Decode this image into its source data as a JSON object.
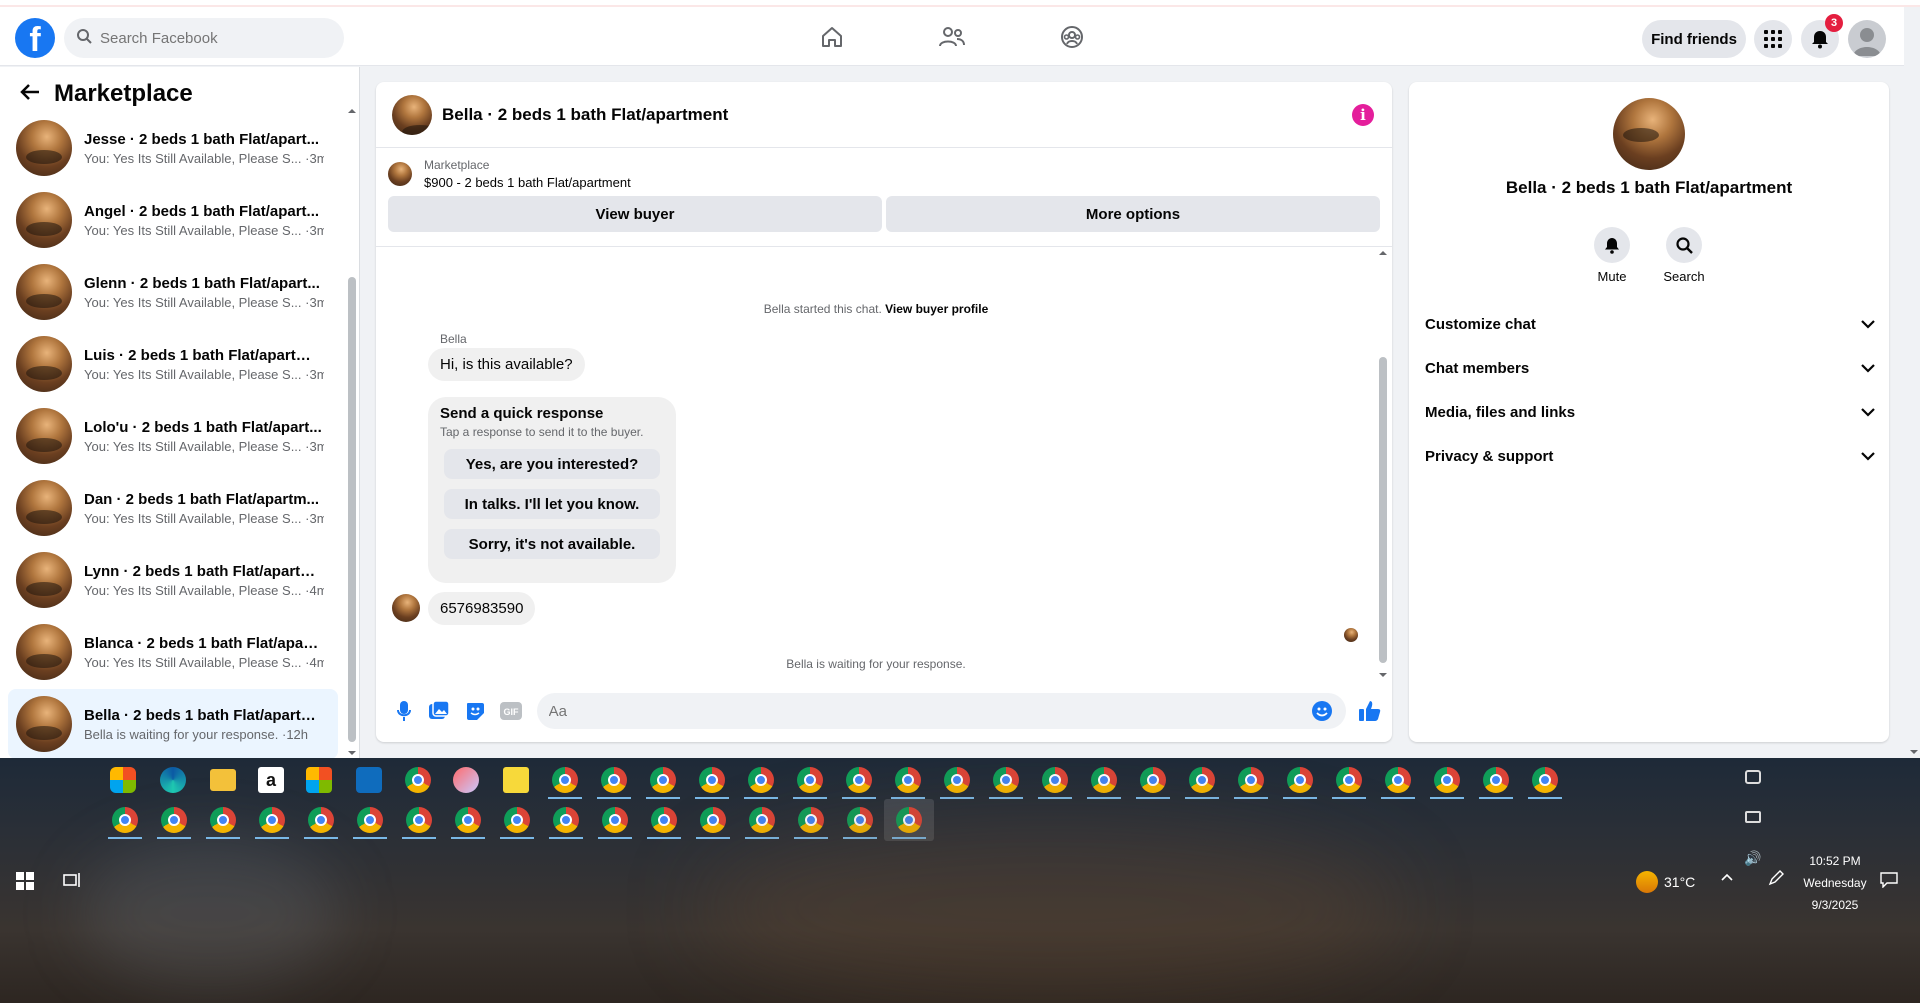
{
  "navbar": {
    "logo": "f",
    "search_placeholder": "Search Facebook",
    "find_friends": "Find friends",
    "notification_count": "3"
  },
  "sidebar": {
    "title": "Marketplace",
    "conversations": [
      {
        "title": "Jesse · 2 beds 1 bath Flat/apart...",
        "sub": "You: Yes Its Still Available, Please S... ·3m"
      },
      {
        "title": "Angel · 2 beds 1 bath Flat/apart...",
        "sub": "You: Yes Its Still Available, Please S... ·3m"
      },
      {
        "title": "Glenn · 2 beds 1 bath Flat/apart...",
        "sub": "You: Yes Its Still Available, Please S... ·3m"
      },
      {
        "title": "Luis · 2 beds 1 bath Flat/apartme...",
        "sub": "You: Yes Its Still Available, Please S... ·3m"
      },
      {
        "title": "Lolo'u · 2 beds 1 bath Flat/apart...",
        "sub": "You: Yes Its Still Available, Please S... ·3m"
      },
      {
        "title": "Dan · 2 beds 1 bath Flat/apartm...",
        "sub": "You: Yes Its Still Available, Please S... ·3m"
      },
      {
        "title": "Lynn · 2 beds 1 bath Flat/apartm...",
        "sub": "You: Yes Its Still Available, Please S... ·4m"
      },
      {
        "title": "Blanca · 2 beds 1 bath Flat/apart...",
        "sub": "You: Yes Its Still Available, Please S... ·4m"
      },
      {
        "title": "Bella · 2 beds 1 bath Flat/apartm...",
        "sub": "Bella is waiting for your response. ·12h"
      }
    ]
  },
  "chat": {
    "title": "Bella · 2 beds 1 bath Flat/apartment",
    "marketplace_label": "Marketplace",
    "listing": "$900 - 2 beds 1 bath Flat/apartment",
    "view_buyer": "View buyer",
    "more_options": "More options",
    "started_text": "Bella started this chat.",
    "view_profile": "View buyer profile",
    "sender_name": "Bella",
    "first_message": "Hi, is this available?",
    "quick_title": "Send a quick response",
    "quick_sub": "Tap a response to send it to the buyer.",
    "quick_options": [
      "Yes, are you interested?",
      "In talks. I'll let you know.",
      "Sorry, it's not available."
    ],
    "second_message": "6576983590",
    "waiting_text": "Bella is waiting for your response.",
    "composer_placeholder": "Aa"
  },
  "right_panel": {
    "title": "Bella · 2 beds 1 bath Flat/apartment",
    "mute": "Mute",
    "search": "Search",
    "sections": [
      "Customize chat",
      "Chat members",
      "Media, files and links",
      "Privacy & support"
    ]
  },
  "taskbar": {
    "weather": "31°C",
    "time": "10:52 PM",
    "day": "Wednesday",
    "date": "9/3/2025"
  },
  "colors": {
    "brand": "#1877f2",
    "active_conv": "#ebf5ff",
    "badge": "#e41e3f",
    "info": "#e41e9b"
  }
}
